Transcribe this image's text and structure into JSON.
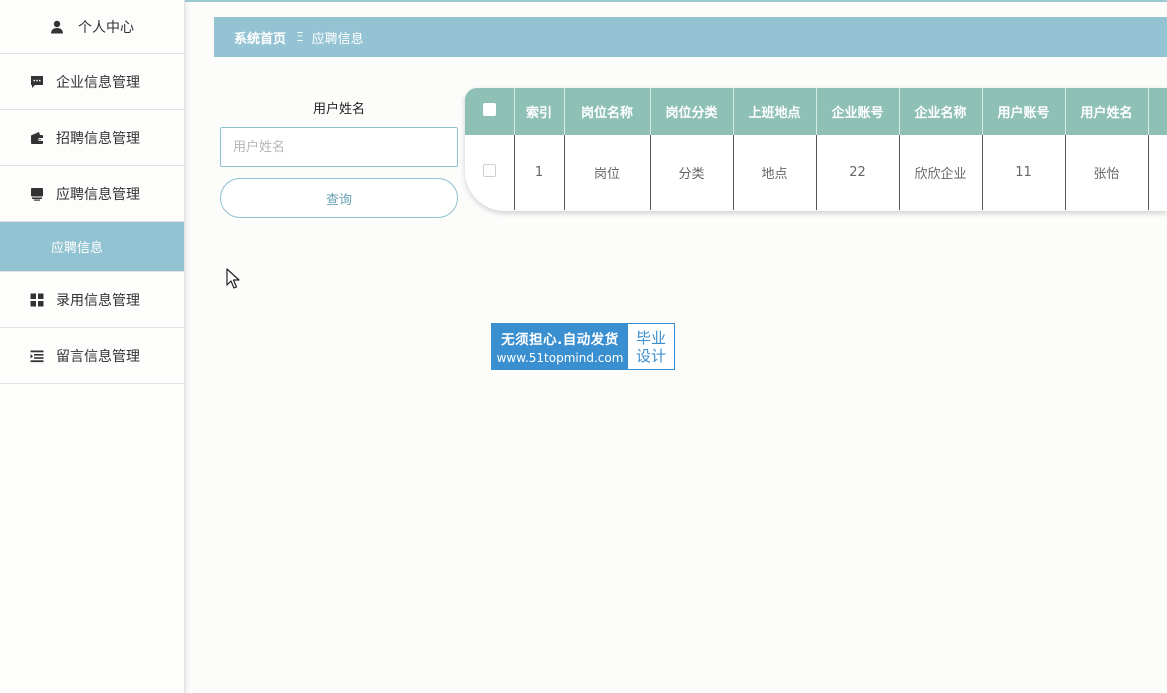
{
  "sidebar": {
    "items": [
      {
        "label": "个人中心",
        "icon": "user-icon"
      },
      {
        "label": "企业信息管理",
        "icon": "message-icon"
      },
      {
        "label": "招聘信息管理",
        "icon": "wallet-icon"
      },
      {
        "label": "应聘信息管理",
        "icon": "monitor-icon"
      },
      {
        "label": "录用信息管理",
        "icon": "grid-icon"
      },
      {
        "label": "留言信息管理",
        "icon": "list-icon"
      }
    ],
    "submenu": {
      "label": "应聘信息"
    }
  },
  "breadcrumb": {
    "home": "系统首页",
    "separator": "Ξ",
    "current": "应聘信息"
  },
  "search": {
    "label": "用户姓名",
    "placeholder": "用户姓名",
    "button": "查询"
  },
  "table": {
    "columns": [
      "索引",
      "岗位名称",
      "岗位分类",
      "上班地点",
      "企业账号",
      "企业名称",
      "用户账号",
      "用户姓名"
    ],
    "rows": [
      [
        "1",
        "岗位",
        "分类",
        "地点",
        "22",
        "欣欣企业",
        "11",
        "张怡"
      ]
    ]
  },
  "watermark": {
    "line1": "无须担心.自动发货",
    "line2": "www.51topmind.com",
    "right1": "毕业",
    "right2": "设计"
  },
  "colors": {
    "accent": "#94c4d3",
    "table_header": "#8fc0b6",
    "watermark_blue": "#3a8fd0"
  }
}
